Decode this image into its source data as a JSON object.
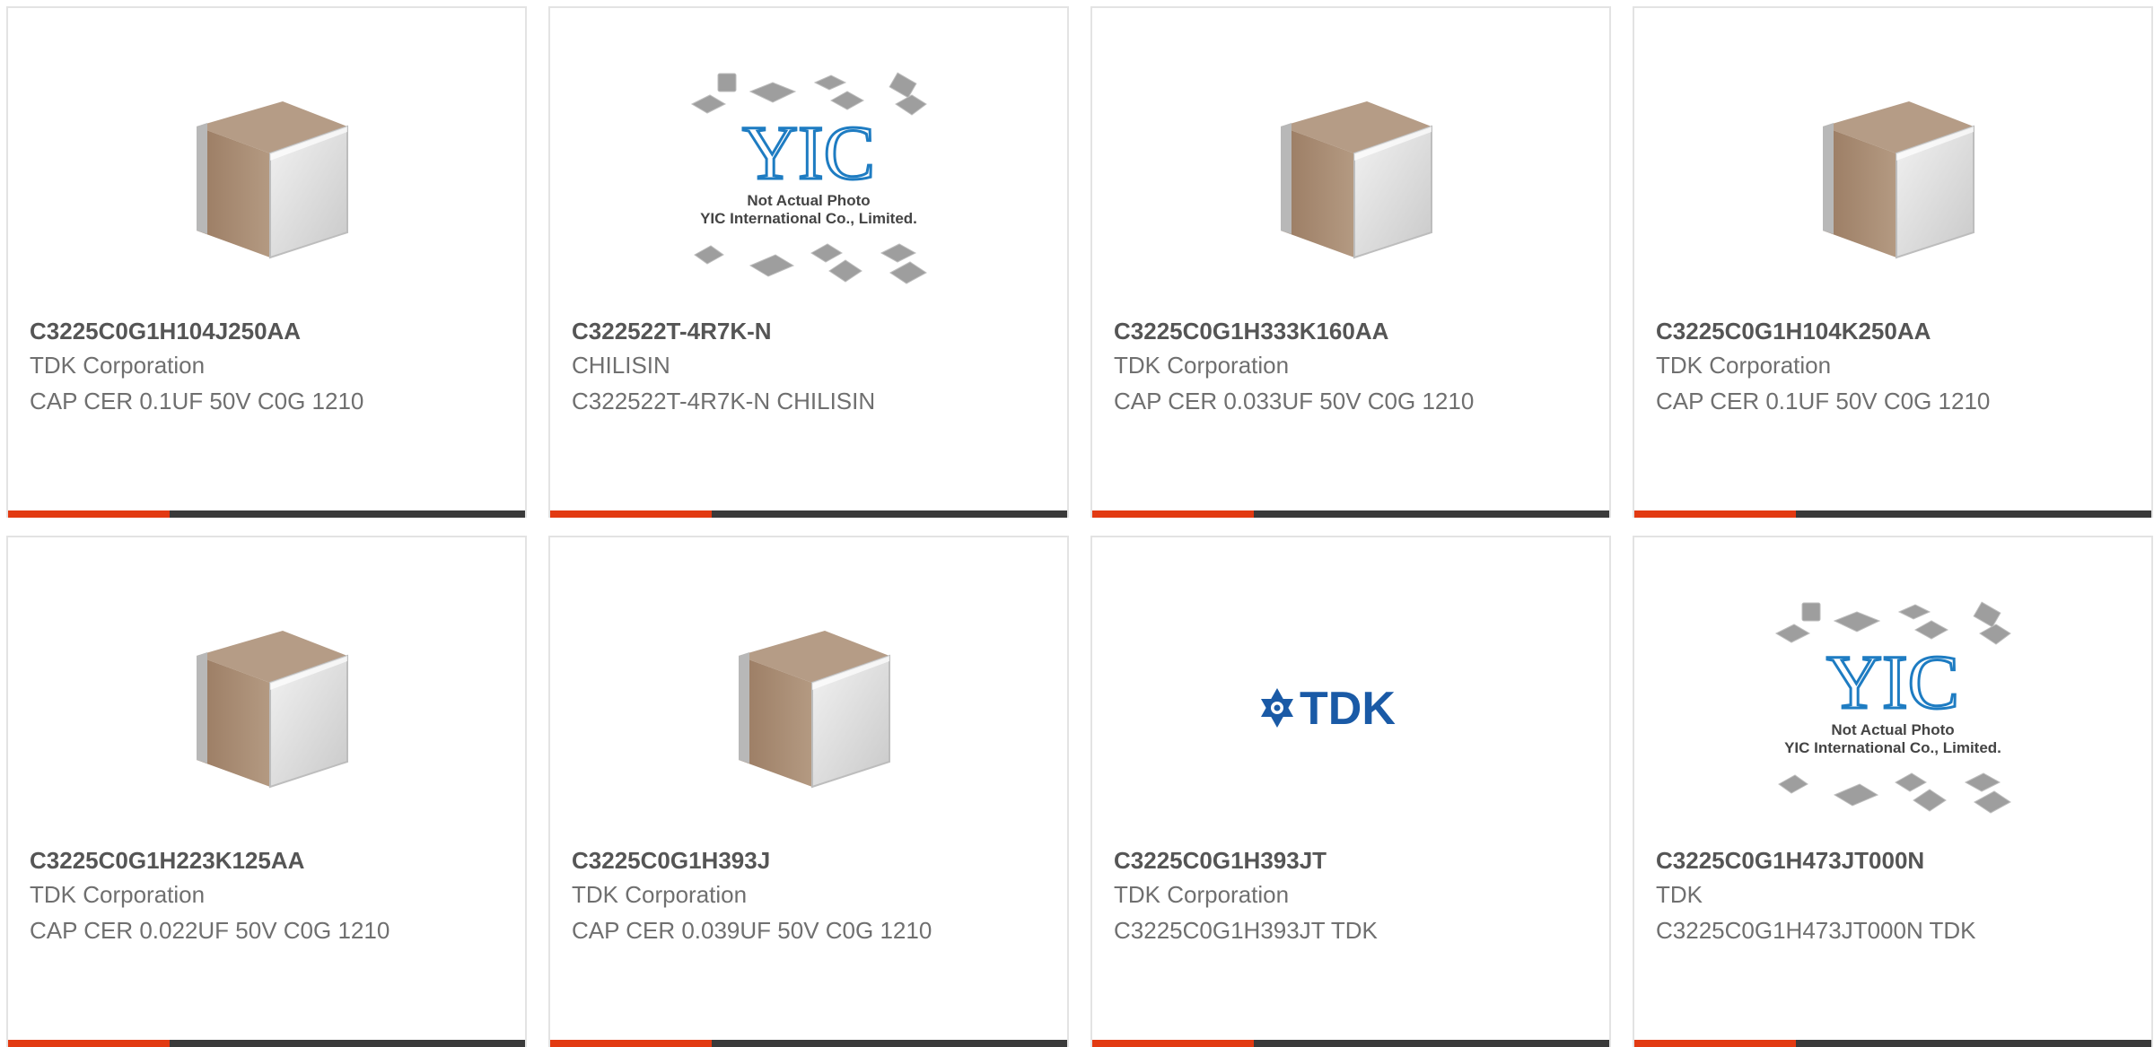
{
  "colors": {
    "accent": "#e23a12",
    "bar": "#3a3a3a",
    "border": "#e3e3e3",
    "title": "#555555",
    "text": "#6f6f6f"
  },
  "cards": [
    {
      "part": "C3225C0G1H104J250AA",
      "manufacturer": "TDK Corporation",
      "description": "CAP CER 0.1UF 50V C0G 1210",
      "image": "capacitor-chip-icon"
    },
    {
      "part": "C322522T-4R7K-N",
      "manufacturer": "CHILISIN",
      "description": "C322522T-4R7K-N CHILISIN",
      "image": "yic-not-actual-photo"
    },
    {
      "part": "C3225C0G1H333K160AA",
      "manufacturer": "TDK Corporation",
      "description": "CAP CER 0.033UF 50V C0G 1210",
      "image": "capacitor-chip-icon"
    },
    {
      "part": "C3225C0G1H104K250AA",
      "manufacturer": "TDK Corporation",
      "description": "CAP CER 0.1UF 50V C0G 1210",
      "image": "capacitor-chip-icon"
    },
    {
      "part": "C3225C0G1H223K125AA",
      "manufacturer": "TDK Corporation",
      "description": "CAP CER 0.022UF 50V C0G 1210",
      "image": "capacitor-chip-icon"
    },
    {
      "part": "C3225C0G1H393J",
      "manufacturer": "TDK Corporation",
      "description": "CAP CER 0.039UF 50V C0G 1210",
      "image": "capacitor-chip-icon"
    },
    {
      "part": "C3225C0G1H393JT",
      "manufacturer": "TDK Corporation",
      "description": "C3225C0G1H393JT TDK",
      "image": "tdk-logo"
    },
    {
      "part": "C3225C0G1H473JT000N",
      "manufacturer": "TDK",
      "description": "C3225C0G1H473JT000N TDK",
      "image": "yic-not-actual-photo"
    }
  ],
  "yic": {
    "logo_text": "YIC",
    "line1": "Not Actual Photo",
    "line2": "YIC International Co., Limited."
  },
  "tdk_logo_text": "TDK"
}
